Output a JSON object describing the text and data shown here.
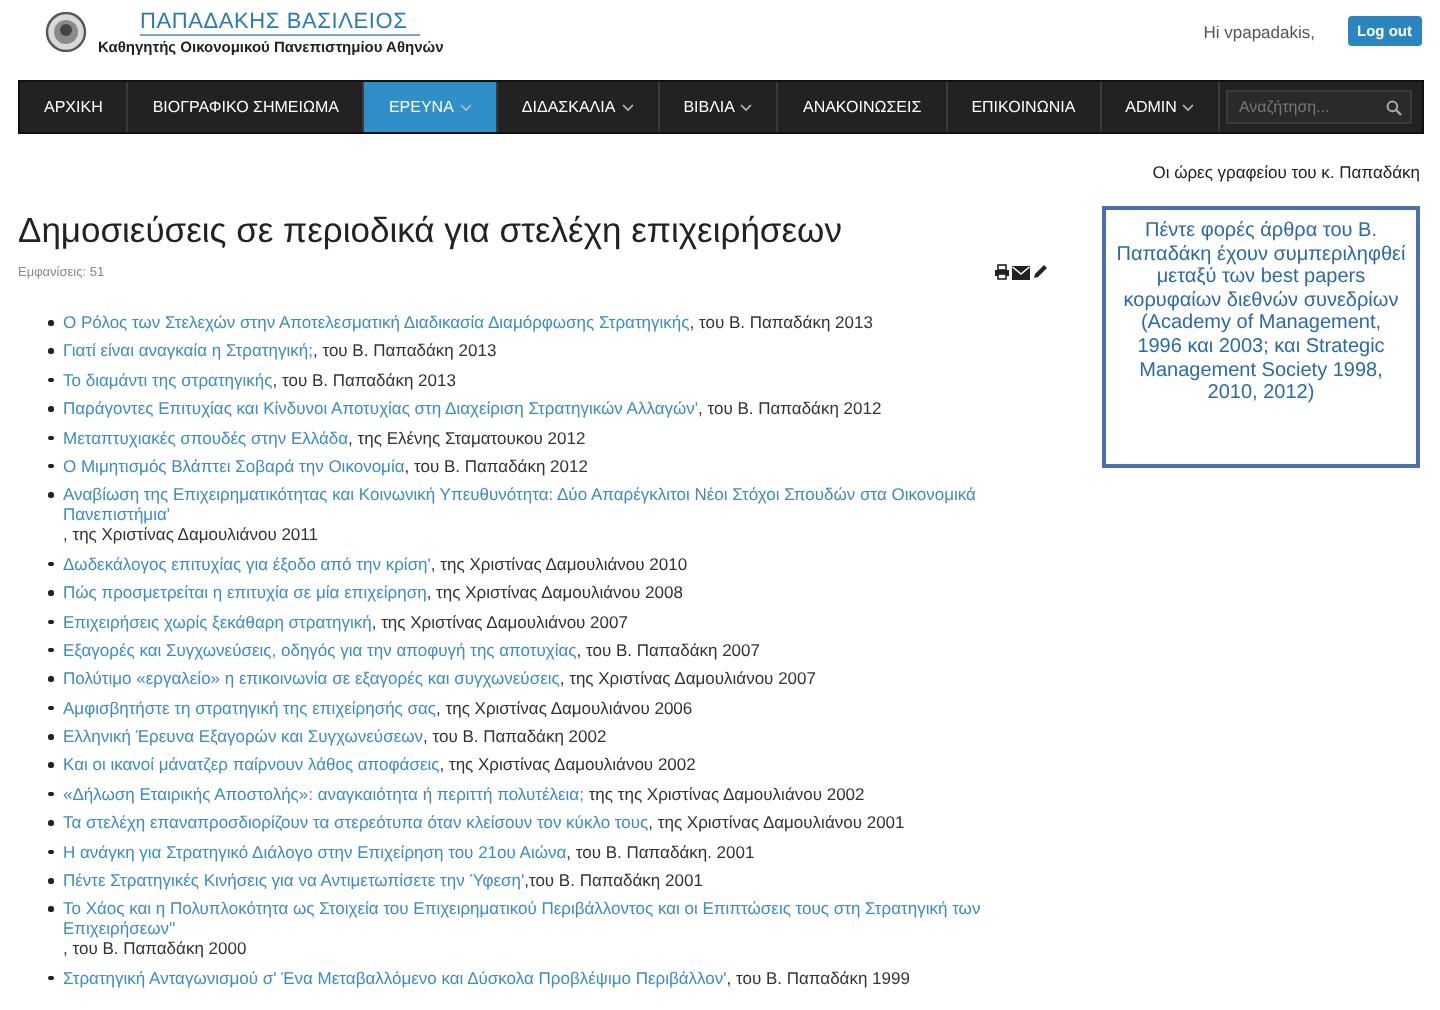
{
  "header": {
    "site_title": "ΠΑΠΑΔΑΚΗΣ ΒΑΣΙΛΕΙΟΣ",
    "subtitle": "Καθηγητής Οικονομικού Πανεπιστημίου Αθηνών",
    "greeting": "Hi vpapadakis,",
    "logout_button": "Log out"
  },
  "nav": {
    "items": [
      {
        "label": "ΑΡΧΙΚΗ",
        "selected": false,
        "dropdown": false
      },
      {
        "label": "ΒΙΟΓΡΑΦΙΚΟ ΣΗΜΕΙΩΜΑ",
        "selected": false,
        "dropdown": false
      },
      {
        "label": "ΕΡΕΥΝΑ",
        "selected": true,
        "dropdown": true
      },
      {
        "label": "ΔΙΔΑΣΚΑΛΙΑ",
        "selected": false,
        "dropdown": true
      },
      {
        "label": "ΒΙΒΛΙΑ",
        "selected": false,
        "dropdown": true
      },
      {
        "label": "ΑΝΑΚΟΙΝΩΣΕΙΣ",
        "selected": false,
        "dropdown": false
      },
      {
        "label": "ΕΠΙΚΟΙΝΩΝΙΑ",
        "selected": false,
        "dropdown": false
      },
      {
        "label": "ADMIN",
        "selected": false,
        "dropdown": true
      }
    ],
    "search": {
      "placeholder": "Αναζήτηση..."
    }
  },
  "ticker": "Οι ώρες γραφείου του κ. Παπαδάκη",
  "article": {
    "title": "Δημοσιεύσεις σε περιοδικά για στελέχη επιχειρήσεων",
    "hits": "Εμφανίσεις: 51",
    "publications": [
      {
        "link": "Ο Ρόλος των Στελεχών στην Αποτελεσματική Διαδικασία Διαμόρφωσης Στρατηγικής",
        "byline": ", του Β. Παπαδάκη 2013"
      },
      {
        "link": "Γιατί είναι αναγκαία η Στρατηγική;",
        "byline": ", του Β. Παπαδάκη 2013"
      },
      {
        "link": "Το διαμάντι της στρατηγικής",
        "byline": ", του Β. Παπαδάκη 2013"
      },
      {
        "link": "Παράγοντες Επιτυχίας και Κίνδυνοι Αποτυχίας στη Διαχείριση Στρατηγικών Αλλαγών'",
        "byline": ", του Β. Παπαδάκη 2012"
      },
      {
        "link": "Μεταπτυχιακές σπουδές στην Ελλάδα",
        "byline": ", της Ελένης Σταματουκου 2012"
      },
      {
        "link": "Ο Μιμητισμός Βλάπτει Σοβαρά την Οικονομία",
        "byline": ", του Β. Παπαδάκη 2012"
      },
      {
        "link": "Αναβίωση της Επιχειρηματικότητας και Κοινωνική Υπευθυνότητα:  Δύο Απαρέγκλιτοι Νέοι Στόχοι Σπουδών στα Οικονομικά Πανεπιστήμια'",
        "byline": ", της Χριστίνας Δαμουλιάνου 2011"
      },
      {
        "link": "Δωδεκάλογος επιτυχίας για έξοδο από την κρίση'",
        "byline": ", της Χριστίνας Δαμουλιάνου 2010"
      },
      {
        "link": "Πώς προσμετρείται η επιτυχία σε μία επιχείρηση",
        "byline": ", της Χριστίνας Δαμουλιάνου 2008"
      },
      {
        "link": "Επιχειρήσεις χωρίς ξεκάθαρη στρατηγική",
        "byline": ", της Χριστίνας Δαμουλιάνου 2007"
      },
      {
        "link": "Εξαγορές και Συγχωνεύσεις, οδηγός για την αποφυγή της αποτυχίας",
        "byline": ", του Β. Παπαδάκη 2007"
      },
      {
        "link": "Πολύτιμο «εργαλείο» η επικοινωνία σε εξαγορές και συγχωνεύσεις",
        "byline": ", της Χριστίνας Δαμουλιάνου 2007"
      },
      {
        "link": "Αμφισβητήστε τη στρατηγική της επιχείρησής σας",
        "byline": ", της Χριστίνας Δαμουλιάνου 2006"
      },
      {
        "link": "Ελληνική Έρευνα Εξαγορών και Συγχωνεύσεων",
        "byline": ", του Β. Παπαδάκη 2002"
      },
      {
        "link": "Και οι ικανοί μάνατζερ παίρνουν λάθος αποφάσεις",
        "byline": ", της Χριστίνας Δαμουλιάνου 2002"
      },
      {
        "link": "«Δήλωση Εταιρικής Αποστολής»: αναγκαιότητα ή περιττή πολυτέλεια;",
        "byline": " της της Χριστίνας Δαμουλιάνου 2002"
      },
      {
        "link": "Τα στελέχη επαναπροσδιορίζουν τα στερεότυπα όταν κλείσουν τον κύκλο τους",
        "byline": ", της Χριστίνας Δαμουλιάνου 2001"
      },
      {
        "link": "Η ανάγκη για Στρατηγικό Διάλογο στην Επιχείρηση του 21ου Αιώνα",
        "byline": ", του Β. Παπαδάκη. 2001"
      },
      {
        "link": "Πέντε Στρατηγικές Κινήσεις για να Αντιμετωπίσετε την Ύφεση'",
        "byline": ",του Β. Παπαδάκη 2001"
      },
      {
        "link": "Το Χάος και η Πολυπλοκότητα ως Στοιχεία του Επιχειρηματικού Περιβάλλοντος και οι Επιπτώσεις τους στη Στρατηγική των Επιχειρήσεων''",
        "byline": ", του Β. Παπαδάκη 2000"
      },
      {
        "link": "Στρατηγική Ανταγωνισμού σ' Ένα Μεταβαλλόμενο και Δύσκολα Προβλέψιμο Περιβάλλον'",
        "byline": ", του Β. Παπαδάκη 1999"
      }
    ]
  },
  "sidebar": {
    "notice": "Πέντε φορές άρθρα του Β. Παπαδάκη έχουν συμπεριληφθεί μεταξύ των best papers κορυφαίων διεθνών συνεδρίων (Academy of Management, 1996 και 2003; και Strategic Management Society 1998, 2010, 2012)"
  }
}
